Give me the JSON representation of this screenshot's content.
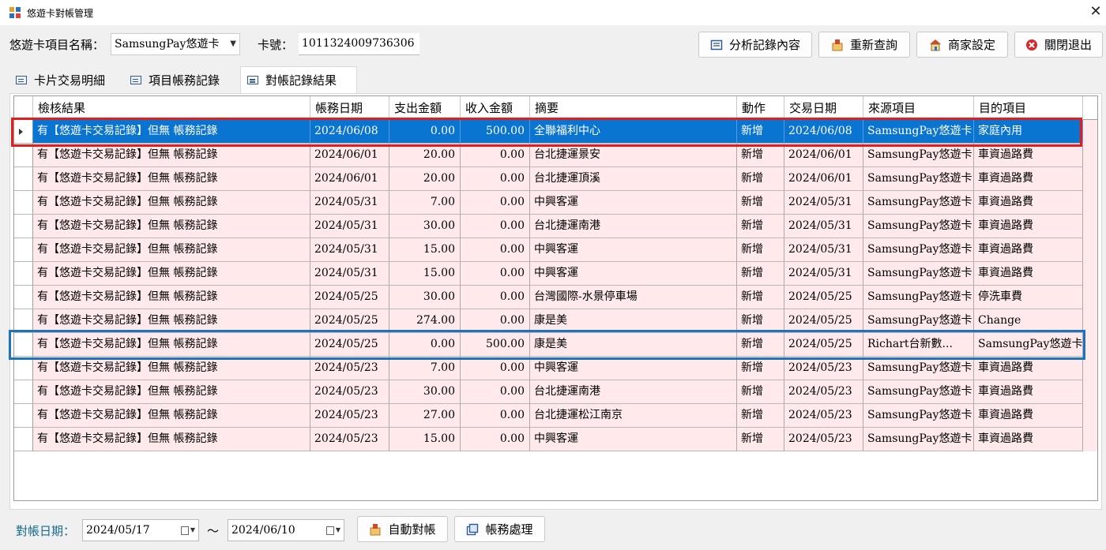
{
  "window": {
    "title": "悠遊卡對帳管理",
    "close_label": "✕"
  },
  "toolbar": {
    "project_label": "悠遊卡項目名稱：",
    "project_value": "SamsungPay悠遊卡",
    "card_label": "卡號：",
    "card_value": "1011324009736306",
    "buttons": {
      "analyze": "分析記錄內容",
      "requery": "重新查詢",
      "merchant": "商家設定",
      "close": "關閉退出"
    }
  },
  "tabs": [
    "卡片交易明細",
    "項目帳務記錄",
    "對帳記錄結果"
  ],
  "active_tab": "對帳記錄結果",
  "grid": {
    "columns": [
      "檢核結果",
      "帳務日期",
      "支出金額",
      "收入金額",
      "摘要",
      "動作",
      "交易日期",
      "來源項目",
      "目的項目"
    ],
    "rows": [
      [
        "有【悠遊卡交易記錄】但無 帳務記錄",
        "2024/06/08",
        "0.00",
        "500.00",
        "全聯福利中心",
        "新增",
        "2024/06/08",
        "SamsungPay悠遊卡",
        "家庭內用"
      ],
      [
        "有【悠遊卡交易記錄】但無 帳務記錄",
        "2024/06/01",
        "20.00",
        "0.00",
        "台北捷運景安",
        "新增",
        "2024/06/01",
        "SamsungPay悠遊卡",
        "車資過路費"
      ],
      [
        "有【悠遊卡交易記錄】但無 帳務記錄",
        "2024/06/01",
        "20.00",
        "0.00",
        "台北捷運頂溪",
        "新增",
        "2024/06/01",
        "SamsungPay悠遊卡",
        "車資過路費"
      ],
      [
        "有【悠遊卡交易記錄】但無 帳務記錄",
        "2024/05/31",
        "7.00",
        "0.00",
        "中興客運",
        "新增",
        "2024/05/31",
        "SamsungPay悠遊卡",
        "車資過路費"
      ],
      [
        "有【悠遊卡交易記錄】但無 帳務記錄",
        "2024/05/31",
        "30.00",
        "0.00",
        "台北捷運南港",
        "新增",
        "2024/05/31",
        "SamsungPay悠遊卡",
        "車資過路費"
      ],
      [
        "有【悠遊卡交易記錄】但無 帳務記錄",
        "2024/05/31",
        "15.00",
        "0.00",
        "中興客運",
        "新增",
        "2024/05/31",
        "SamsungPay悠遊卡",
        "車資過路費"
      ],
      [
        "有【悠遊卡交易記錄】但無 帳務記錄",
        "2024/05/31",
        "15.00",
        "0.00",
        "中興客運",
        "新增",
        "2024/05/31",
        "SamsungPay悠遊卡",
        "車資過路費"
      ],
      [
        "有【悠遊卡交易記錄】但無 帳務記錄",
        "2024/05/25",
        "30.00",
        "0.00",
        "台灣國際-水景停車場",
        "新增",
        "2024/05/25",
        "SamsungPay悠遊卡",
        "停洗車費"
      ],
      [
        "有【悠遊卡交易記錄】但無 帳務記錄",
        "2024/05/25",
        "274.00",
        "0.00",
        "康是美",
        "新增",
        "2024/05/25",
        "SamsungPay悠遊卡",
        "Change"
      ],
      [
        "有【悠遊卡交易記錄】但無 帳務記錄",
        "2024/05/25",
        "0.00",
        "500.00",
        "康是美",
        "新增",
        "2024/05/25",
        "Richart台新數...",
        "SamsungPay悠遊卡"
      ],
      [
        "有【悠遊卡交易記錄】但無 帳務記錄",
        "2024/05/23",
        "7.00",
        "0.00",
        "中興客運",
        "新增",
        "2024/05/23",
        "SamsungPay悠遊卡",
        "車資過路費"
      ],
      [
        "有【悠遊卡交易記錄】但無 帳務記錄",
        "2024/05/23",
        "30.00",
        "0.00",
        "台北捷運南港",
        "新增",
        "2024/05/23",
        "SamsungPay悠遊卡",
        "車資過路費"
      ],
      [
        "有【悠遊卡交易記錄】但無 帳務記錄",
        "2024/05/23",
        "27.00",
        "0.00",
        "台北捷運松江南京",
        "新增",
        "2024/05/23",
        "SamsungPay悠遊卡",
        "車資過路費"
      ],
      [
        "有【悠遊卡交易記錄】但無 帳務記錄",
        "2024/05/23",
        "15.00",
        "0.00",
        "中興客運",
        "新增",
        "2024/05/23",
        "SamsungPay悠遊卡",
        "車資過路費"
      ]
    ]
  },
  "footer": {
    "date_label": "對帳日期：",
    "date_from": "2024/05/17",
    "separator": "～",
    "date_to": "2024/06/10",
    "auto_button": "自動對帳",
    "process_button": "帳務處理"
  },
  "colors": {
    "selected": "#0a74d1",
    "row_bg": "#ffe9ea",
    "highlight_red": "#e31c1c",
    "highlight_blue": "#1f73bd"
  }
}
